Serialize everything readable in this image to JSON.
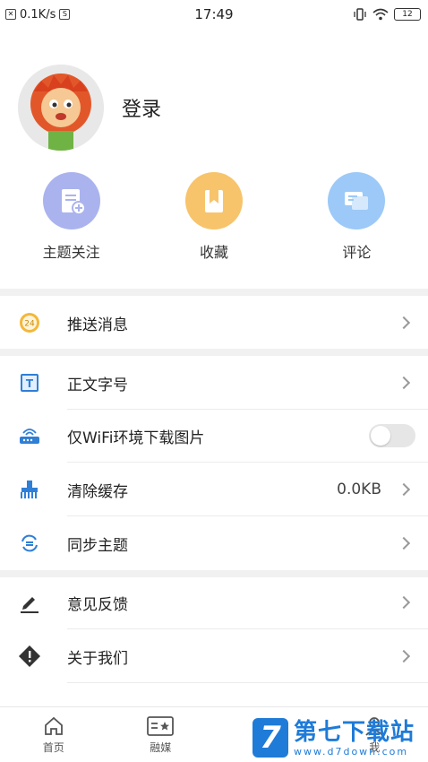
{
  "status_bar": {
    "speed": "0.1K/s",
    "time": "17:49",
    "battery": "12"
  },
  "profile": {
    "login_label": "登录"
  },
  "quick_actions": [
    {
      "label": "主题关注",
      "icon": "topic-follow-icon",
      "color": "#aab3ee"
    },
    {
      "label": "收藏",
      "icon": "bookmark-icon",
      "color": "#f7c46c"
    },
    {
      "label": "评论",
      "icon": "comment-icon",
      "color": "#9cc9f7"
    }
  ],
  "menu": {
    "push": {
      "label": "推送消息",
      "icon": "push-24-icon"
    },
    "font_size": {
      "label": "正文字号",
      "icon": "text-size-icon"
    },
    "wifi_images": {
      "label": "仅WiFi环境下载图片",
      "icon": "router-icon",
      "enabled": false
    },
    "clear_cache": {
      "label": "清除缓存",
      "value": "0.0KB",
      "icon": "brush-icon"
    },
    "sync_topics": {
      "label": "同步主题",
      "icon": "sync-icon"
    },
    "feedback": {
      "label": "意见反馈",
      "icon": "pencil-icon"
    },
    "about": {
      "label": "关于我们",
      "icon": "info-diamond-icon"
    }
  },
  "bottom_nav": [
    {
      "label": "首页",
      "icon": "home-icon"
    },
    {
      "label": "融媒",
      "icon": "media-icon"
    },
    {
      "label": "",
      "icon": "hidden-tab-icon"
    },
    {
      "label": "我",
      "icon": "user-icon"
    }
  ],
  "watermark": {
    "text": "第七下载站",
    "url": "www.d7down.com"
  },
  "colors": {
    "accent_blue": "#1e7bd8",
    "divider": "#f1f1f1"
  }
}
